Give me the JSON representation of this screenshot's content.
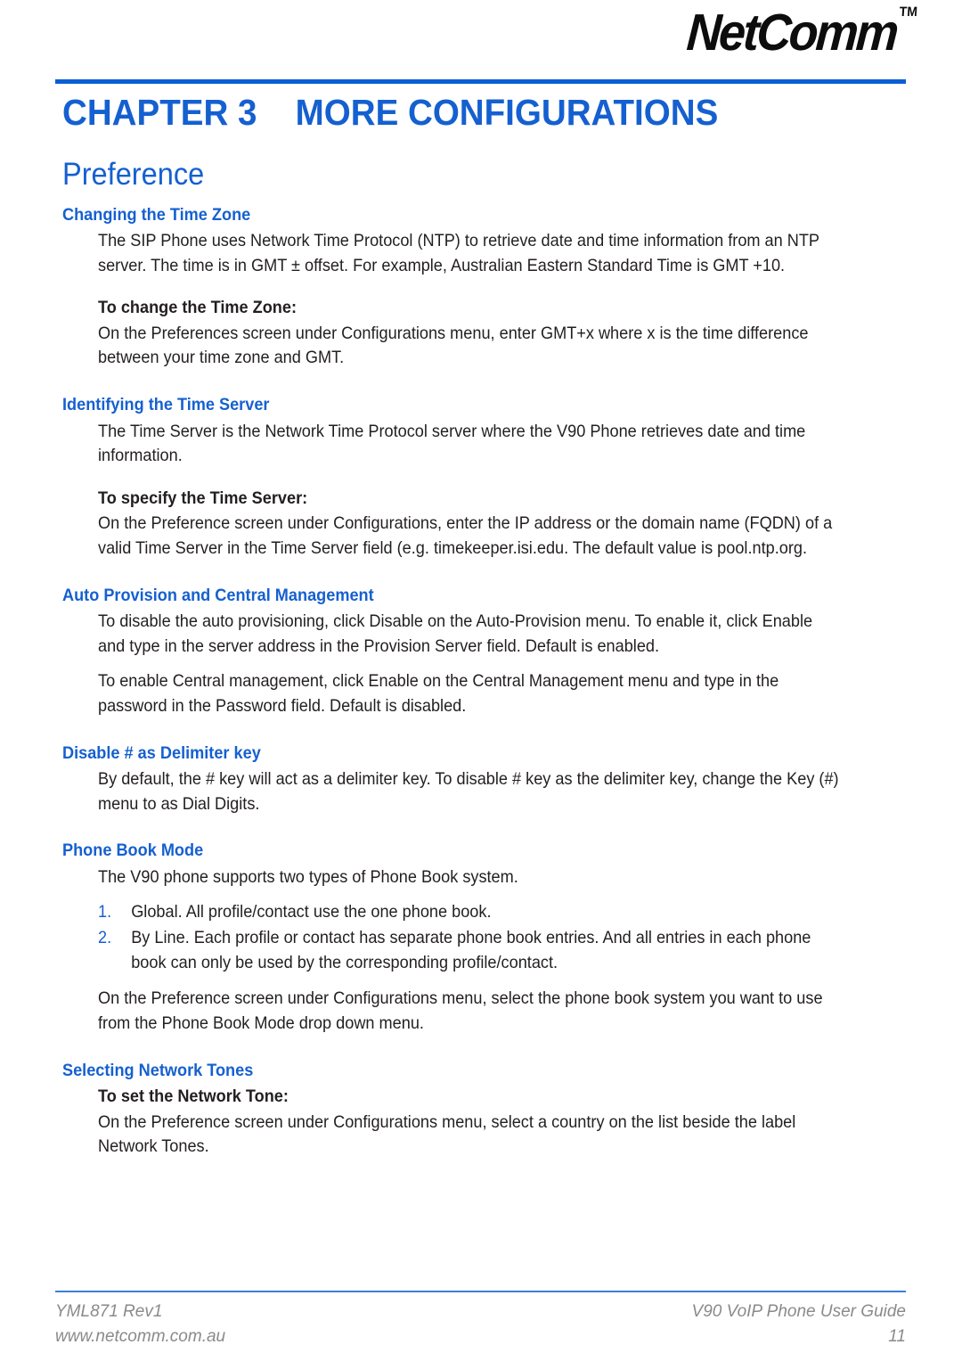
{
  "header": {
    "logo_text": "NetComm",
    "logo_tm": "TM"
  },
  "chapter": {
    "number_label": "CHAPTER 3",
    "title": "MORE CONFIGURATIONS"
  },
  "colors": {
    "brand_blue": "#1560d0",
    "rule_blue": "#0a5fd4",
    "footer_rule_blue": "#3d7fd6",
    "body_text": "#231f20",
    "footer_text": "#8a8a8a"
  },
  "section": {
    "title": "Preference"
  },
  "blocks": {
    "time_zone": {
      "heading": "Changing the Time Zone",
      "para1": "The SIP Phone uses Network Time Protocol (NTP) to retrieve date and time information from an NTP server. The time is in GMT ± offset. For example, Australian Eastern Standard Time is GMT +10.",
      "sub1": "To change the Time Zone:",
      "para2": "On the Preferences screen under Configurations menu, enter GMT+x where x is the time difference between your time zone and GMT."
    },
    "time_server": {
      "heading": "Identifying the Time Server",
      "para1": "The Time Server is the Network Time Protocol server where the V90 Phone retrieves date and time information.",
      "sub1": "To specify the Time Server:",
      "para2": "On the Preference screen under Configurations, enter the IP address or the domain name (FQDN) of a valid Time Server in the Time Server field (e.g. timekeeper.isi.edu. The default value is pool.ntp.org."
    },
    "auto_provision": {
      "heading": "Auto Provision and Central Management",
      "para1": "To disable the auto provisioning, click Disable on the Auto-Provision menu. To enable it, click Enable and type in the server address in the Provision Server field. Default is enabled.",
      "para2": "To enable Central management, click Enable on the Central Management menu and type in the password in the Password field. Default is disabled."
    },
    "delimiter": {
      "heading": "Disable # as Delimiter key",
      "para1": "By default, the # key will act as a delimiter key. To disable # key as the delimiter key, change the Key (#) menu to as Dial Digits."
    },
    "phone_book": {
      "heading": "Phone Book Mode",
      "para1": "The V90 phone supports two types of Phone Book system.",
      "list": [
        {
          "marker": "1.",
          "text": "Global. All profile/contact use the one phone book."
        },
        {
          "marker": "2.",
          "text": "By Line. Each profile or contact has separate phone book entries. And all entries in each phone book can only be used by the corresponding profile/contact."
        }
      ],
      "para2": "On the Preference screen under Configurations menu, select the phone book system you want to use from the Phone Book Mode drop down menu."
    },
    "network_tones": {
      "heading": "Selecting Network Tones",
      "sub1": "To set the Network Tone:",
      "para1": "On the Preference screen under Configurations menu, select a country on the list beside the label Network Tones."
    }
  },
  "footer": {
    "doc_code": "YML871 Rev1",
    "website": "www.netcomm.com.au",
    "guide_title": "V90 VoIP Phone User Guide",
    "page_number": "11"
  }
}
